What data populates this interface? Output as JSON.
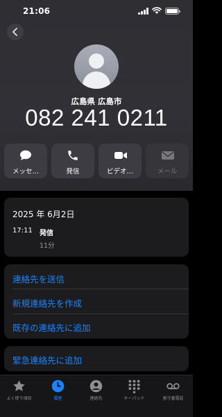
{
  "status_bar": {
    "time": "21:06"
  },
  "contact": {
    "location": "広島県 広島市",
    "phone_number": "082 241 0211"
  },
  "actions": [
    {
      "label": "メッセ…",
      "icon": "message-icon",
      "enabled": true
    },
    {
      "label": "発信",
      "icon": "phone-icon",
      "enabled": true
    },
    {
      "label": "ビデオ…",
      "icon": "video-icon",
      "enabled": true
    },
    {
      "label": "メール",
      "icon": "mail-icon",
      "enabled": false
    }
  ],
  "history": {
    "date": "2025 年 6月2日",
    "time": "17:11",
    "type": "発信",
    "duration": "11分"
  },
  "contact_actions": [
    {
      "label": "連絡先を送信"
    },
    {
      "label": "新規連絡先を作成"
    },
    {
      "label": "既存の連絡先に追加"
    }
  ],
  "emergency": {
    "label": "緊急連絡先に追加"
  },
  "tabs": [
    {
      "label": "よく使う項目",
      "icon": "star-icon",
      "active": false
    },
    {
      "label": "履歴",
      "icon": "clock-icon",
      "active": true
    },
    {
      "label": "連絡先",
      "icon": "contacts-icon",
      "active": false
    },
    {
      "label": "キーパッド",
      "icon": "keypad-icon",
      "active": false
    },
    {
      "label": "留守番電話",
      "icon": "voicemail-icon",
      "active": false
    }
  ],
  "colors": {
    "accent": "#1a84ff",
    "background": "#000000",
    "card": "#1c1c1e",
    "header": "#2e2e33",
    "action_button": "#3c3c42"
  }
}
